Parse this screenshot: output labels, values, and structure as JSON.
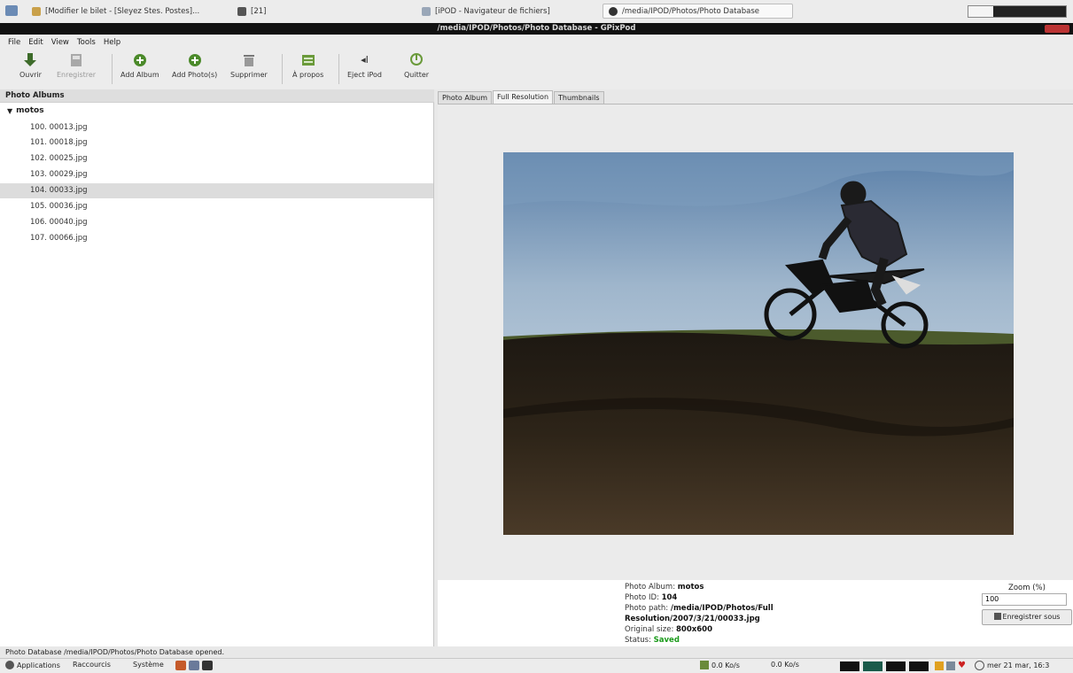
{
  "taskbar": {
    "tasks": [
      {
        "label": "[Modifier le bilet - [Sleyez Stes. Postes]...",
        "active": false
      },
      {
        "label": "[21]",
        "active": false
      },
      {
        "label": "[iPOD - Navigateur de fichiers]",
        "active": false
      },
      {
        "label": "/media/IPOD/Photos/Photo Database",
        "active": true
      }
    ]
  },
  "window": {
    "title": "/media/IPOD/Photos/Photo Database - GPixPod"
  },
  "menubar": {
    "items": [
      "File",
      "Edit",
      "View",
      "Tools",
      "Help"
    ]
  },
  "toolbar": {
    "buttons": [
      {
        "label": "Ouvrir",
        "icon": "open-icon",
        "enabled": true
      },
      {
        "label": "Enregistrer",
        "icon": "save-icon",
        "enabled": false
      },
      {
        "label": "Add Album",
        "icon": "add-album-icon",
        "enabled": true
      },
      {
        "label": "Add Photo(s)",
        "icon": "add-photos-icon",
        "enabled": true
      },
      {
        "label": "Supprimer",
        "icon": "delete-icon",
        "enabled": true
      },
      {
        "label": "À propos",
        "icon": "about-icon",
        "enabled": true
      },
      {
        "label": "Eject iPod",
        "icon": "eject-icon",
        "enabled": true
      },
      {
        "label": "Quitter",
        "icon": "quit-icon",
        "enabled": true
      }
    ]
  },
  "albums": {
    "header": "Photo Albums",
    "root": "motos",
    "photos": [
      {
        "label": "100. 00013.jpg",
        "selected": false
      },
      {
        "label": "101. 00018.jpg",
        "selected": false
      },
      {
        "label": "102. 00025.jpg",
        "selected": false
      },
      {
        "label": "103. 00029.jpg",
        "selected": false
      },
      {
        "label": "104. 00033.jpg",
        "selected": true
      },
      {
        "label": "105. 00036.jpg",
        "selected": false
      },
      {
        "label": "106. 00040.jpg",
        "selected": false
      },
      {
        "label": "107. 00066.jpg",
        "selected": false
      }
    ]
  },
  "tabs": [
    {
      "label": "Photo Album",
      "active": false
    },
    {
      "label": "Full Resolution",
      "active": true
    },
    {
      "label": "Thumbnails",
      "active": false
    }
  ],
  "info": {
    "album_label": "Photo Album:",
    "album_value": "motos",
    "id_label": "Photo ID:",
    "id_value": "104",
    "path_label": "Photo path:",
    "path_value_1": "/media/IPOD/Photos/Full",
    "path_value_2": "Resolution/2007/3/21/00033.jpg",
    "size_label": "Original size:",
    "size_value": "800x600",
    "status_label": "Status:",
    "status_value": "Saved"
  },
  "zoom": {
    "label": "Zoom (%)",
    "value": "100",
    "save_button": "Enregistrer sous"
  },
  "statusbar": {
    "text": "Photo Database /media/IPOD/Photos/Photo Database opened."
  },
  "bottom_panel": {
    "menus": [
      "Applications",
      "Raccourcis",
      "Système"
    ],
    "net_down": "0.0 Ko/s",
    "net_up": "0.0 Ko/s",
    "clock": "mer 21 mar, 16:3"
  },
  "colors": {
    "sky_top": "#5a7fa8",
    "sky_bottom": "#cfdbe6",
    "ground": "#2b2218",
    "grass": "#4b5a2c",
    "status_green": "#1a9a1a"
  }
}
